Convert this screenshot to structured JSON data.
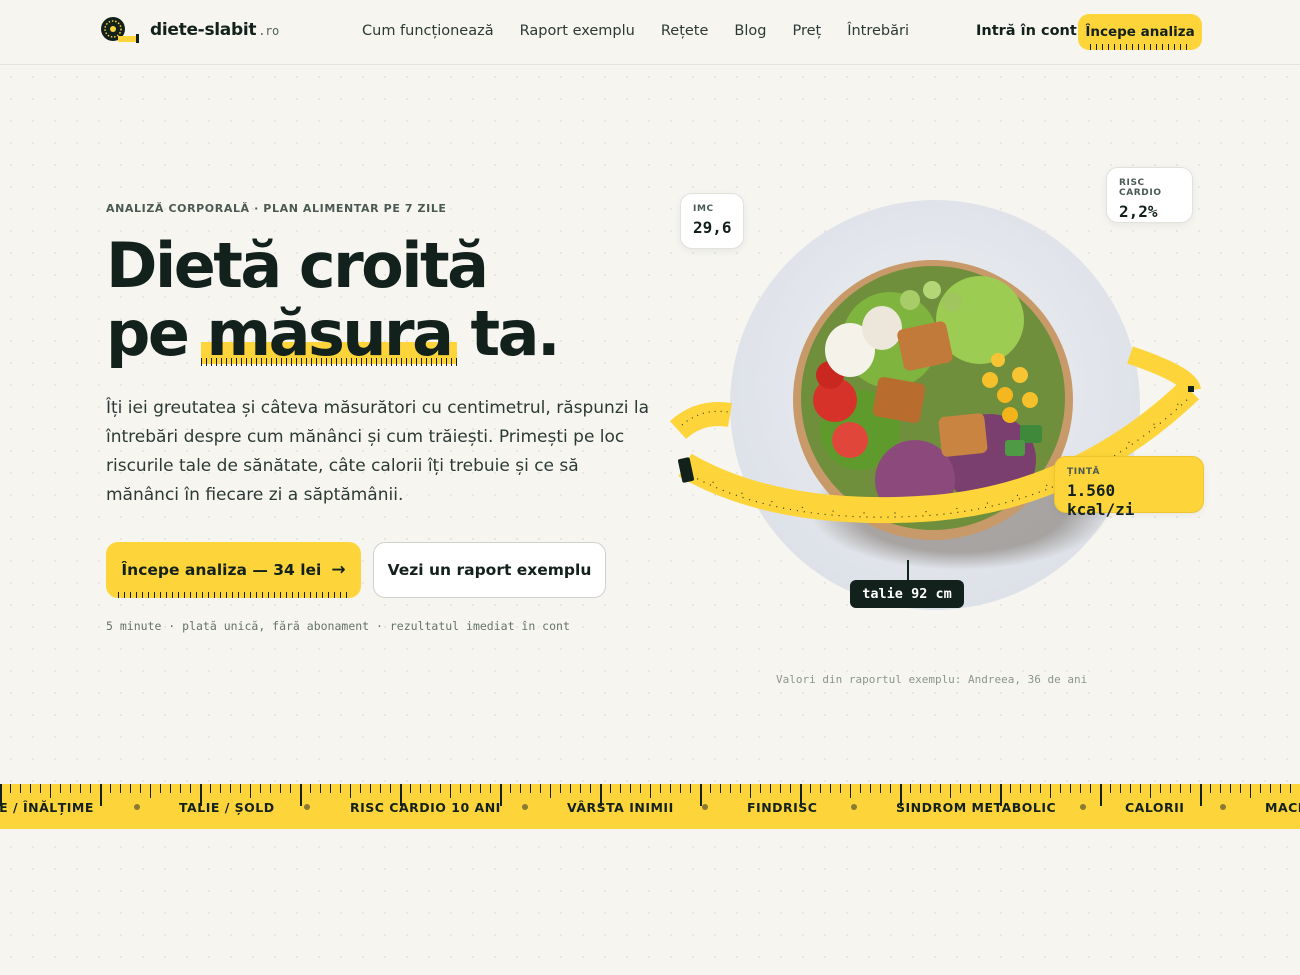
{
  "brand": {
    "name": "diete-slabit",
    "tld": ".ro"
  },
  "nav": {
    "links": [
      "Cum funcționează",
      "Raport exemplu",
      "Rețete",
      "Blog",
      "Preț",
      "Întrebări"
    ],
    "login": "Intră în cont",
    "cta": "Începe analiza"
  },
  "hero": {
    "eyebrow": "ANALIZĂ CORPORALĂ · PLAN ALIMENTAR PE 7 ZILE",
    "title_line1": "Dietă croită",
    "title_pre": "pe ",
    "title_highlight": "măsura",
    "title_post": " ta.",
    "lead": "Îți iei greutatea și câteva măsurători cu centimetrul, răspunzi la întrebări despre cum mănânci și cum trăiești. Primești pe loc riscurile tale de sănătate, câte calorii îți trebuie și ce să mănânci în fiecare zi a săptămânii.",
    "cta_primary": "Începe analiza — 34 lei",
    "cta_secondary": "Vezi un raport exemplu",
    "fineprint": "5 minute · plată unică, fără abonament · rezultatul imediat în cont"
  },
  "visual": {
    "imc": {
      "label": "IMC",
      "value": "29,6"
    },
    "risk": {
      "label": "RISC CARDIO",
      "value": "2,2%"
    },
    "target": {
      "label": "ȚINTĂ",
      "value": "1.560 kcal/zi"
    },
    "waist": "talie 92 cm",
    "caption": "Valori din raportul exemplu: Andreea, 36 de ani"
  },
  "ruler": {
    "items": [
      "IE / ÎNĂLȚIME",
      "TALIE / ȘOLD",
      "RISC CARDIO 10 ANI",
      "VÂRSTA INIMII",
      "FINDRISC",
      "SINDROM METABOLIC",
      "CALORII",
      "MACR"
    ]
  },
  "colors": {
    "accent": "#fdd43a",
    "ink": "#12211c",
    "background": "#f6f5f0"
  }
}
